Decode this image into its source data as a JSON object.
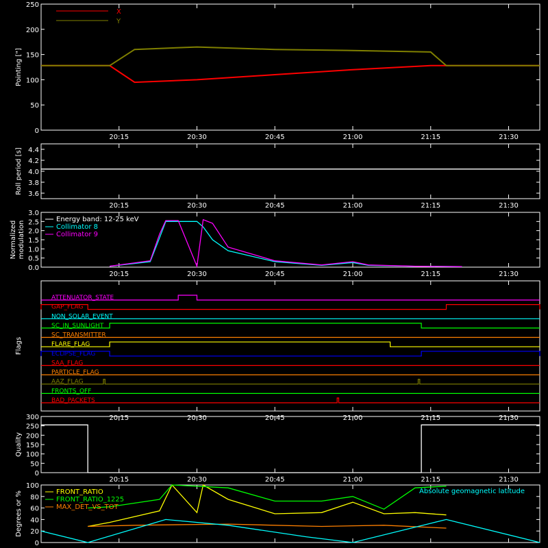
{
  "chart_data": [
    {
      "id": "pointing",
      "type": "line",
      "ylabel": "Pointing [\"]",
      "ylim": [
        0,
        250
      ],
      "yticks": [
        0,
        50,
        100,
        150,
        200,
        250
      ],
      "xticks": [
        "20:15",
        "20:30",
        "20:45",
        "21:00",
        "21:15",
        "21:30"
      ],
      "legend_position": "top-left",
      "series": [
        {
          "name": "X",
          "color": "#ff0000",
          "x": [
            20.0,
            20.22,
            20.3,
            20.5,
            20.75,
            21.0,
            21.25,
            21.3,
            21.6
          ],
          "y": [
            128,
            128,
            95,
            100,
            110,
            120,
            128,
            128,
            128
          ]
        },
        {
          "name": "Y",
          "color": "#808000",
          "x": [
            20.0,
            20.22,
            20.3,
            20.5,
            20.75,
            21.0,
            21.25,
            21.3,
            21.6
          ],
          "y": [
            128,
            128,
            160,
            165,
            160,
            158,
            155,
            128,
            128
          ]
        }
      ]
    },
    {
      "id": "roll",
      "type": "line",
      "ylabel": "Roll period [s]",
      "ylim": [
        3.5,
        4.5
      ],
      "yticks": [
        "3.6",
        "3.8",
        "4.0",
        "4.2",
        "4.4"
      ],
      "xticks": [
        "20:15",
        "20:30",
        "20:45",
        "21:00",
        "21:15",
        "21:30"
      ],
      "series": [
        {
          "color": "#ffffff",
          "x": [
            20.0,
            21.6
          ],
          "y": [
            4.04,
            4.04
          ]
        }
      ]
    },
    {
      "id": "modulation",
      "type": "line",
      "ylabel": "Normalized modulation",
      "ylim": [
        0,
        3.0
      ],
      "yticks": [
        "0.0",
        "0.5",
        "1.0",
        "1.5",
        "2.0",
        "2.5",
        "3.0"
      ],
      "xticks": [
        "20:15",
        "20:30",
        "20:45",
        "21:00",
        "21:15",
        "21:30"
      ],
      "legend_position": "top-left",
      "legend_title": "Energy band: 12-25 keV",
      "series": [
        {
          "name": "Collimator 8",
          "color": "#00ffff",
          "x": [
            20.22,
            20.35,
            20.38,
            20.4,
            20.5,
            20.52,
            20.55,
            20.6,
            20.75,
            20.9,
            21.0,
            21.05,
            21.2,
            21.35
          ],
          "y": [
            0.05,
            0.3,
            1.6,
            2.5,
            2.5,
            2.2,
            1.5,
            0.9,
            0.3,
            0.1,
            0.25,
            0.1,
            0.05,
            0.03
          ]
        },
        {
          "name": "Collimator 9",
          "color": "#ff00ff",
          "x": [
            20.22,
            20.35,
            20.38,
            20.4,
            20.44,
            20.5,
            20.52,
            20.55,
            20.6,
            20.75,
            20.9,
            21.0,
            21.05,
            21.2,
            21.35
          ],
          "y": [
            0.05,
            0.35,
            1.8,
            2.55,
            2.55,
            0.05,
            2.6,
            2.4,
            1.1,
            0.35,
            0.12,
            0.3,
            0.12,
            0.05,
            0.03
          ]
        }
      ]
    },
    {
      "id": "flags",
      "type": "line",
      "ylabel": "Flags",
      "xticks": [
        "20:15",
        "20:30",
        "20:45",
        "21:00",
        "21:15",
        "21:30"
      ],
      "flags": [
        {
          "name": "ATTENUATOR_STATE",
          "color": "#ff00ff",
          "on": [
            [
              20.44,
              20.5
            ]
          ]
        },
        {
          "name": "GAP_FLAG",
          "color": "#ff0000",
          "on": [
            [
              20.0,
              20.15
            ],
            [
              21.3,
              21.6
            ]
          ]
        },
        {
          "name": "NON_SOLAR_EVENT",
          "color": "#00ffff",
          "on": []
        },
        {
          "name": "SC_IN_SUNLIGHT",
          "color": "#00ff00",
          "on": [
            [
              20.22,
              21.22
            ]
          ]
        },
        {
          "name": "SC_TRANSMITTER",
          "color": "#ff8000",
          "on": []
        },
        {
          "name": "FLARE_FLAG",
          "color": "#ffff00",
          "on": [
            [
              20.22,
              21.12
            ]
          ]
        },
        {
          "name": "ECLIPSE_FLAG",
          "color": "#0000ff",
          "on": [
            [
              20.0,
              20.22
            ],
            [
              21.22,
              21.6
            ]
          ]
        },
        {
          "name": "SAA_FLAG",
          "color": "#ff0000",
          "on": []
        },
        {
          "name": "PARTICLE_FLAG",
          "color": "#ff8000",
          "on": []
        },
        {
          "name": "AAZ_FLAG",
          "color": "#808000",
          "on": [
            [
              20.2,
              20.205
            ],
            [
              21.21,
              21.215
            ]
          ]
        },
        {
          "name": "FRONTS_OFF",
          "color": "#00ff00",
          "on": []
        },
        {
          "name": "BAD_PACKETS",
          "color": "#ff0000",
          "on": [
            [
              20.95,
              20.955
            ]
          ]
        }
      ]
    },
    {
      "id": "quality",
      "type": "line",
      "ylabel": "Quality",
      "ylim": [
        0,
        300
      ],
      "yticks": [
        0,
        50,
        100,
        150,
        200,
        250,
        300
      ],
      "xticks": [
        "20:15",
        "20:30",
        "20:45",
        "21:00",
        "21:15",
        "21:30"
      ],
      "series": [
        {
          "color": "#ffffff",
          "x": [
            20.0,
            20.15,
            20.15,
            21.22,
            21.22,
            21.6
          ],
          "y": [
            255,
            255,
            0,
            0,
            255,
            255
          ]
        }
      ]
    },
    {
      "id": "ratios",
      "type": "line",
      "ylabel": "Degrees or %",
      "ylim": [
        0,
        100
      ],
      "yticks": [
        0,
        20,
        40,
        60,
        80,
        100
      ],
      "legend_position": "top-left",
      "series": [
        {
          "name": "FRONT_RATIO",
          "color": "#ffff00",
          "x": [
            20.15,
            20.22,
            20.38,
            20.42,
            20.5,
            20.52,
            20.6,
            20.75,
            20.9,
            21.0,
            21.1,
            21.2,
            21.3
          ],
          "y": [
            28,
            35,
            55,
            100,
            52,
            100,
            75,
            50,
            52,
            70,
            50,
            52,
            48
          ]
        },
        {
          "name": "FRONT_RATIO_1225",
          "color": "#00ff00",
          "x": [
            20.15,
            20.22,
            20.38,
            20.42,
            20.6,
            20.75,
            20.9,
            21.0,
            21.1,
            21.2,
            21.3
          ],
          "y": [
            60,
            62,
            75,
            100,
            95,
            72,
            72,
            80,
            58,
            95,
            98
          ]
        },
        {
          "name": "MAX_DET_VS_TOT",
          "color": "#ff8000",
          "x": [
            20.15,
            20.3,
            20.6,
            20.9,
            21.1,
            21.3
          ],
          "y": [
            28,
            30,
            32,
            28,
            30,
            25
          ]
        },
        {
          "name": "Absolute geomagnetic latitude",
          "color": "#00ffff",
          "x": [
            20.0,
            20.15,
            20.4,
            20.6,
            20.85,
            21.0,
            21.3,
            21.6
          ],
          "y": [
            20,
            0,
            40,
            30,
            10,
            0,
            40,
            0
          ]
        }
      ]
    }
  ]
}
